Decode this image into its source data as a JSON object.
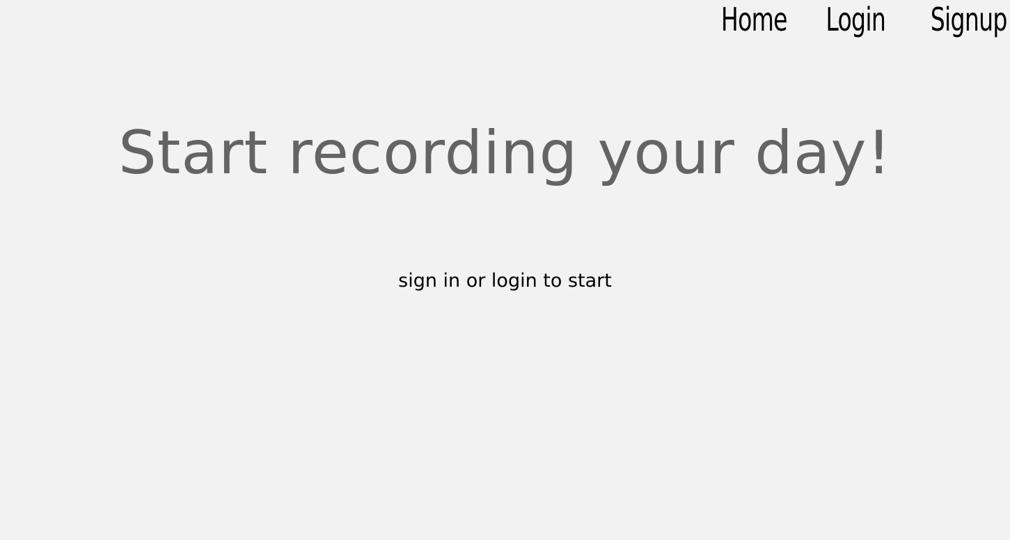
{
  "nav": {
    "home_label": "Home",
    "login_label": "Login",
    "signup_label": "Signup"
  },
  "hero": {
    "title": "Start recording your day!",
    "subtitle": "sign in or login to start"
  },
  "colors": {
    "background": "#f2f2f2",
    "title": "#646464",
    "text": "#000000"
  }
}
